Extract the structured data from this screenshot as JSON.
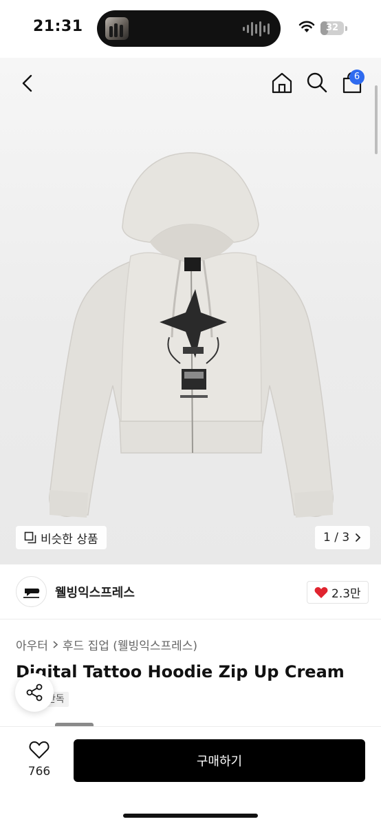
{
  "status_bar": {
    "time": "21:31",
    "battery": "32",
    "battery_level": 0.32
  },
  "nav": {
    "cart_badge": "6"
  },
  "gallery": {
    "similar_label": "비슷한 상품",
    "pager": "1 / 3"
  },
  "brand": {
    "name": "웰빙익스프레스",
    "likes": "2.3만"
  },
  "breadcrumb": {
    "category": "아우터",
    "subcategory": "후드 집업 (웰빙익스프레스)"
  },
  "product": {
    "title": "Digital Tattoo Hoodie Zip Up Cream",
    "tag": "단독"
  },
  "bottom": {
    "wish_count": "766",
    "buy_label": "구매하기"
  },
  "colors": {
    "accent_blue": "#2f6bef",
    "buy_button": "#000000",
    "heart": "#e0242f",
    "hoodie": "#e6e4df"
  },
  "icons": [
    "back-icon",
    "home-icon",
    "search-icon",
    "cart-icon",
    "similar-icon",
    "chevron-right-icon",
    "heart-icon",
    "share-icon",
    "wifi-icon"
  ]
}
